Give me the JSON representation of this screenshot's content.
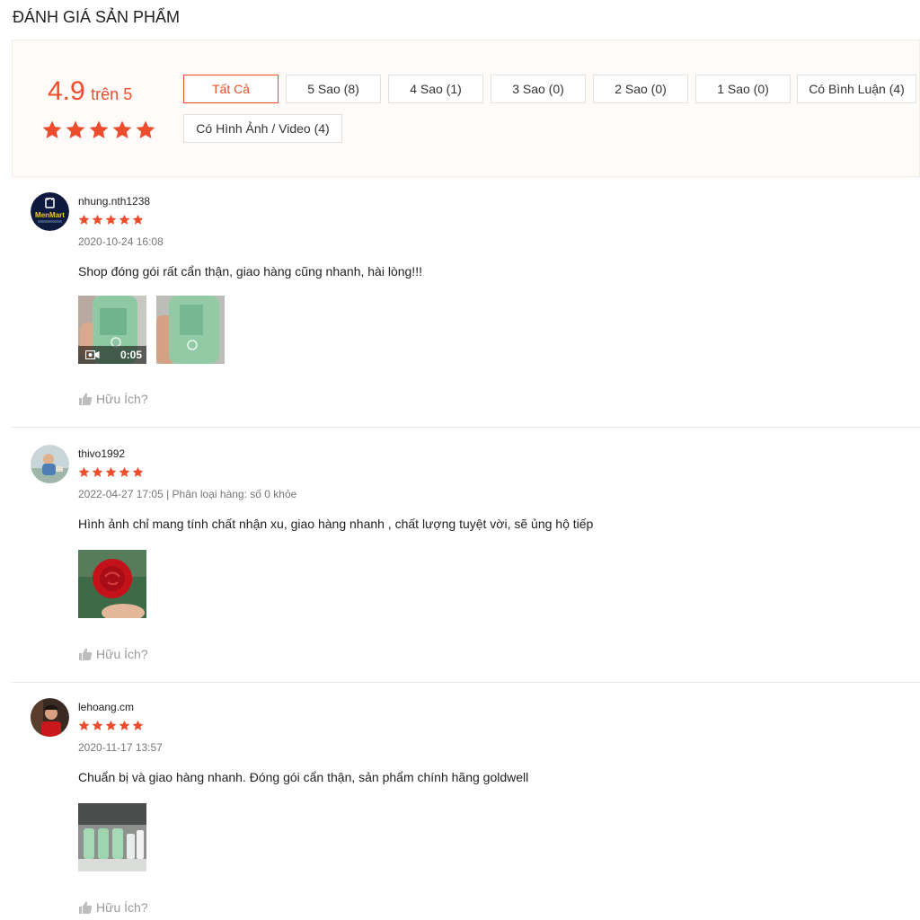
{
  "page_title": "ĐÁNH GIÁ SẢN PHẨM",
  "rating": {
    "score": "4.9",
    "out_of": "trên 5",
    "stars": 5
  },
  "filters": [
    {
      "label": "Tất Cả",
      "active": true
    },
    {
      "label": "5 Sao (8)",
      "active": false
    },
    {
      "label": "4 Sao (1)",
      "active": false
    },
    {
      "label": "3 Sao (0)",
      "active": false
    },
    {
      "label": "2 Sao (0)",
      "active": false
    },
    {
      "label": "1 Sao (0)",
      "active": false
    },
    {
      "label": "Có Bình Luận (4)",
      "active": false
    },
    {
      "label": "Có Hình Ảnh / Video (4)",
      "active": false
    }
  ],
  "reviews": [
    {
      "username": "nhung.nth1238",
      "stars": 5,
      "meta": "2020-10-24 16:08",
      "comment": "Shop đóng gói rất cẩn thận, giao hàng cũng nhanh, hài lòng!!!",
      "avatar_text": "MenMart",
      "video_duration": "0:05",
      "helpful_label": "Hữu Ích?"
    },
    {
      "username": "thivo1992",
      "stars": 5,
      "meta": "2022-04-27 17:05 | Phân loại hàng: số 0 khỏe",
      "comment": "Hình ảnh chỉ mang tính chất nhận xu, giao hàng nhanh , chất lượng tuyệt vời, sẽ ủng hộ tiếp",
      "helpful_label": "Hữu Ích?"
    },
    {
      "username": "lehoang.cm",
      "stars": 5,
      "meta": "2020-11-17 13:57",
      "comment": "Chuẩn bị và giao hàng nhanh. Đóng gói cẩn thận, sản phẩm chính hãng goldwell",
      "helpful_label": "Hữu Ích?"
    }
  ],
  "colors": {
    "accent": "#ee4d2d",
    "muted": "#9a9a9a"
  },
  "icons": [
    "star-icon",
    "video-camera-icon",
    "thumbs-up-icon"
  ]
}
